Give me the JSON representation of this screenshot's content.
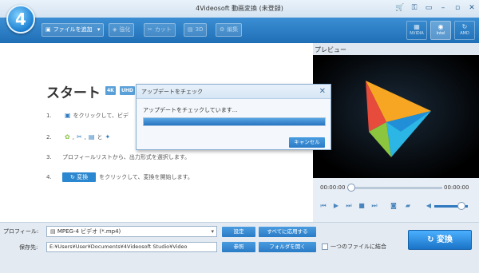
{
  "app": {
    "title": "4Videosoft 動画変換 (未登録)",
    "logo_text": "4"
  },
  "window_controls": [
    "cart-icon",
    "key-icon",
    "chat-icon",
    "minimize-icon",
    "maximize-icon",
    "close-icon"
  ],
  "toolbar": {
    "add_file": "ファイルを追加",
    "enhance": "強化",
    "cut": "カット",
    "threed": "3D",
    "edit": "編集",
    "accel": {
      "nvidia": "NVIDIA",
      "intel": "Intel",
      "amd": "AMD"
    }
  },
  "main": {
    "title": "スタート",
    "badge_4k": "4K",
    "badge_uhd": "UHD",
    "step1_num": "1.",
    "step1_text": "をクリックして、ビデ",
    "step2_num": "2.",
    "step2_sep1": ",",
    "step2_sep2": ",",
    "step2_and": "と",
    "step3_num": "3.",
    "step3_text": "プロフィールリストから、出力形式を選択します。",
    "step4_num": "4.",
    "step4_button": "変換",
    "step4_text": "をクリックして、変換を開始します。"
  },
  "dialog": {
    "title": "アップデートをチェック",
    "message": "アップデートをチェックしています...",
    "progress": 1.0,
    "cancel": "キャンセル"
  },
  "preview": {
    "label": "プレビュー",
    "time_current": "00:00:00",
    "time_total": "00:00:00",
    "volume": 0.8
  },
  "bottom": {
    "profile_label": "プロフィール:",
    "profile_value": "MPEG-4 ビデオ (*.mp4)",
    "settings": "設定",
    "apply_all": "すべてに応用する",
    "save_label": "保存先:",
    "save_path": "E:¥Users¥User¥Documents¥4Videosoft Studio¥Video",
    "browse": "参照",
    "open_folder": "フォルダを開く",
    "merge": "一つのファイルに結合",
    "convert": "変換"
  },
  "colors": {
    "accent": "#2b7fc9",
    "toolbar": "#2a7bc2"
  }
}
